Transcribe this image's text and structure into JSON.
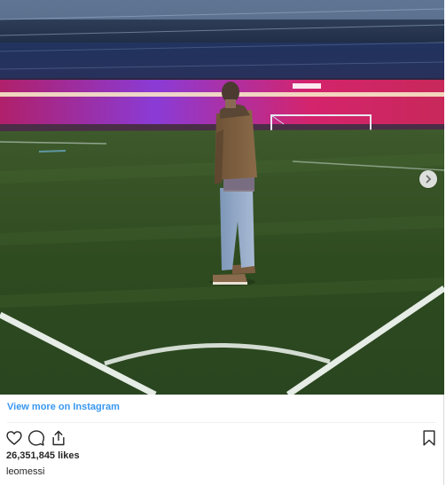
{
  "post": {
    "image_alt": "",
    "view_more_label": "View more on Instagram",
    "likes_text": "26,351,845 likes",
    "username": "leomessi"
  },
  "icons": {
    "next": "chevron-right-icon",
    "like": "heart-icon",
    "comment": "comment-icon",
    "share": "share-icon",
    "save": "bookmark-icon"
  },
  "colors": {
    "link": "#3897f0",
    "text": "#262626",
    "divider": "#efefef"
  }
}
